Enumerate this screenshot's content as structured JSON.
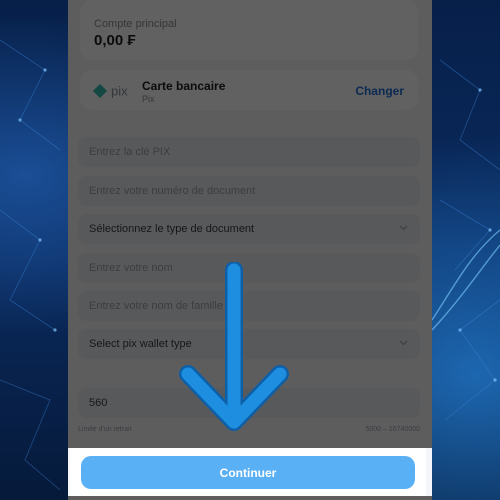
{
  "account": {
    "label": "Compte principal",
    "value": "0,00 ₣"
  },
  "payment_method": {
    "logo_text": "pix",
    "title": "Carte bancaire",
    "subtitle": "Pix",
    "change_label": "Changer"
  },
  "form": {
    "pix_key_placeholder": "Entrez la clé PIX",
    "document_number_placeholder": "Entrez votre numéro de document",
    "document_type_placeholder": "Sélectionnez le type de document",
    "name_placeholder": "Entrez votre nom",
    "family_name_placeholder": "Entrez votre nom de famille",
    "wallet_type_placeholder": "Select pix wallet type",
    "amount_value": "560",
    "limit_label": "Limite d'un retrait",
    "limit_value": "5000 – 16740000"
  },
  "continue_label": "Continuer",
  "colors": {
    "accent": "#1e6fd8",
    "button": "#5ab0f4",
    "arrow": "#1e8fe0"
  },
  "icons": [
    "pix-logo-icon",
    "chevron-down-icon",
    "down-arrow-icon"
  ]
}
